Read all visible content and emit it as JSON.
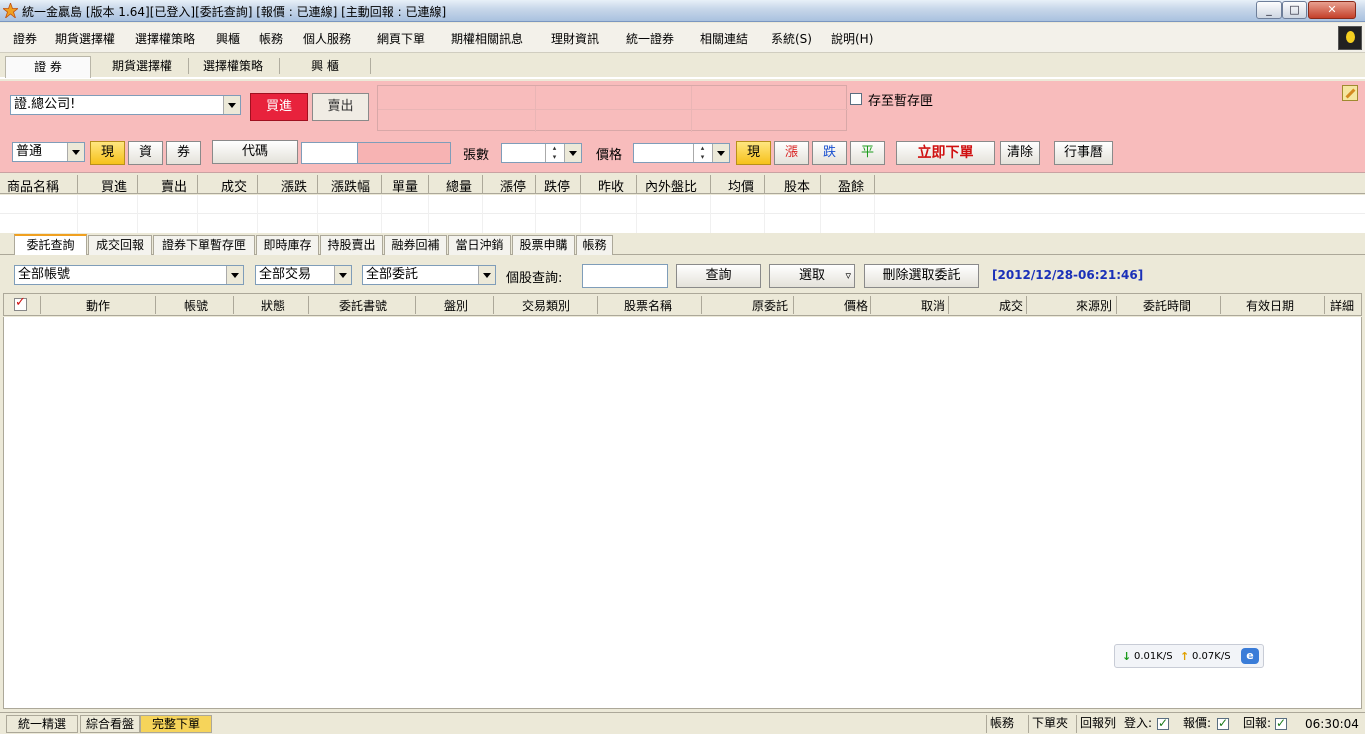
{
  "window": {
    "title": "統一金贏島 [版本 1.64][已登入][委託查詢] [報價 : 已連線] [主動回報 : 已連線]",
    "minimize": "_",
    "maximize": "□",
    "close": "✕"
  },
  "menu": [
    "證券",
    "期貨選擇權",
    "選擇權策略",
    "興櫃",
    "帳務",
    "個人服務",
    "網頁下單",
    "期權相關訊息",
    "理財資訊",
    "統一證券",
    "相關連結",
    "系統(S)",
    "說明(H)"
  ],
  "top_tabs": [
    "證 券",
    "期貨選擇權",
    "選擇權策略",
    "興 櫃"
  ],
  "order": {
    "account": "證.總公司!",
    "buy": "買進",
    "sell": "賣出",
    "save_to_temp": "存至暫存匣",
    "trade_type": "普通",
    "cash": "現",
    "margin": "資",
    "short": "券",
    "code": "代碼",
    "qty_label": "張數",
    "price_label": "價格",
    "price_mode": "現",
    "limit_up": "漲",
    "limit_down": "跌",
    "flat": "平",
    "place_order": "立即下單",
    "clear": "清除",
    "calendar": "行事曆"
  },
  "quote_columns": [
    "商品名稱",
    "買進",
    "賣出",
    "成交",
    "漲跌",
    "漲跌幅",
    "單量",
    "總量",
    "漲停",
    "跌停",
    "昨收",
    "內外盤比",
    "均價",
    "股本",
    "盈餘"
  ],
  "lower_tabs": [
    "委託查詢",
    "成交回報",
    "證券下單暫存匣",
    "即時庫存",
    "持股賣出",
    "融券回補",
    "當日沖銷",
    "股票申購",
    "帳務"
  ],
  "filters": {
    "account": "全部帳號",
    "trade": "全部交易",
    "orders": "全部委託",
    "stock_query_label": "個股查詢:",
    "query": "查詢",
    "select": "選取",
    "select_arrow": "▿",
    "delete_selected": "刪除選取委託",
    "datetime": "[2012/12/28-06:21:46]"
  },
  "order_columns": [
    "動作",
    "帳號",
    "狀態",
    "委託書號",
    "盤別",
    "交易類別",
    "股票名稱",
    "原委託",
    "價格",
    "取消",
    "成交",
    "來源別",
    "委託時間",
    "有效日期",
    "詳細"
  ],
  "netspeed": {
    "down": "0.01K/S",
    "up": "0.07K/S",
    "down_icon": "↓",
    "up_icon": "↑",
    "ie": "e"
  },
  "status": {
    "tabs": [
      "統一精選",
      "綜合看盤",
      "完整下單"
    ],
    "account": "帳務",
    "order_folder": "下單夾",
    "report_list": "回報列",
    "login": "登入:",
    "quote": "報價:",
    "report": "回報:",
    "clock": "06:30:04"
  }
}
